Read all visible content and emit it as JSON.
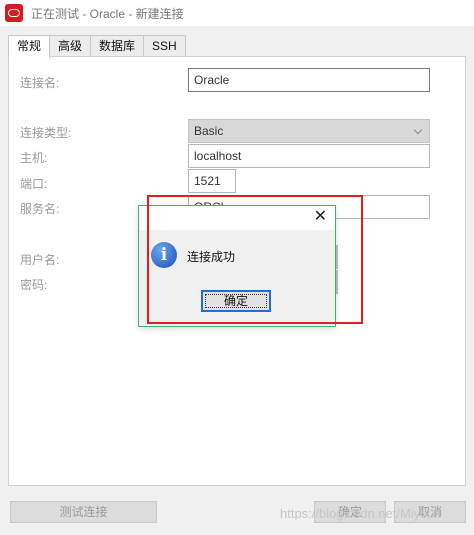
{
  "window": {
    "title": "正在测试 - Oracle - 新建连接",
    "icon": "oracle-app-icon"
  },
  "tabs": [
    {
      "label": "常规",
      "active": true
    },
    {
      "label": "高级",
      "active": false
    },
    {
      "label": "数据库",
      "active": false
    },
    {
      "label": "SSH",
      "active": false
    }
  ],
  "form": {
    "connection_name_label": "连接名:",
    "connection_name_value": "Oracle",
    "connection_type_label": "连接类型:",
    "connection_type_value": "Basic",
    "host_label": "主机:",
    "host_value": "localhost",
    "port_label": "端口:",
    "port_value": "1521",
    "service_name_label": "服务名:",
    "service_name_value": "ORCL",
    "username_label": "用户名:",
    "password_label": "密码:"
  },
  "buttons": {
    "test_connection": "测试连接",
    "ok": "确定",
    "cancel": "取消"
  },
  "dialog": {
    "message": "连接成功",
    "ok_label": "确定",
    "close_glyph": "✕",
    "info_glyph": "i"
  },
  "watermark": "https://blog.csdn.net/Miyouli",
  "colors": {
    "highlight_border": "#e02020",
    "dialog_border": "#3cb371",
    "oracle_red": "#d71920"
  }
}
